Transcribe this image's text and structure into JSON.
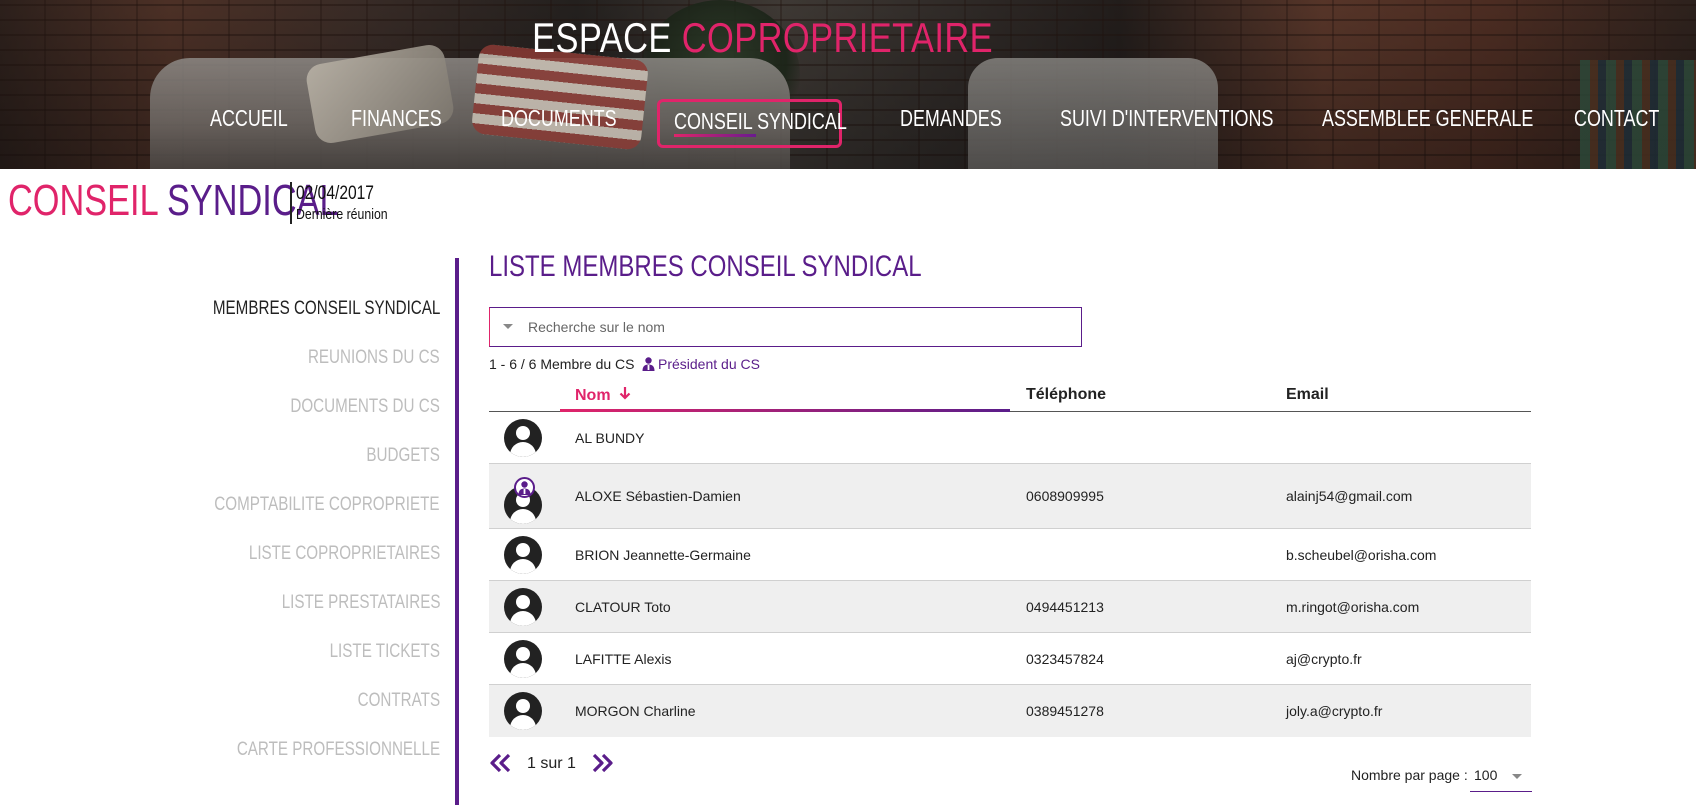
{
  "header": {
    "brand_main": "ESPACE",
    "brand_accent": "COPROPRIETAIRE",
    "nav": [
      {
        "label": "ACCUEIL"
      },
      {
        "label": "FINANCES"
      },
      {
        "label": "DOCUMENTS"
      },
      {
        "label": "CONSEIL SYNDICAL",
        "active": true
      },
      {
        "label": "DEMANDES"
      },
      {
        "label": "SUIVI D'INTERVENTIONS"
      },
      {
        "label": "ASSEMBLEE GENERALE"
      },
      {
        "label": "CONTACT"
      }
    ]
  },
  "page": {
    "title_part1": "CONSEIL",
    "title_part2": "SYNDICAL",
    "meeting_date": "02/04/2017",
    "meeting_label": "Dernière réunion"
  },
  "sidebar": {
    "items": [
      {
        "label": "MEMBRES CONSEIL SYNDICAL",
        "active": true
      },
      {
        "label": "REUNIONS DU CS"
      },
      {
        "label": "DOCUMENTS DU CS"
      },
      {
        "label": "BUDGETS"
      },
      {
        "label": "COMPTABILITE COPROPRIETE"
      },
      {
        "label": "LISTE COPROPRIETAIRES"
      },
      {
        "label": "LISTE PRESTATAIRES"
      },
      {
        "label": "LISTE TICKETS"
      },
      {
        "label": "CONTRATS"
      },
      {
        "label": "CARTE PROFESSIONNELLE"
      }
    ]
  },
  "main": {
    "title": "LISTE MEMBRES CONSEIL SYNDICAL",
    "search_placeholder": "Recherche sur le nom",
    "count_text": "1 - 6 / 6 Membre du CS",
    "president_legend": "Président du CS",
    "columns": {
      "name": "Nom",
      "phone": "Téléphone",
      "email": "Email"
    },
    "members": [
      {
        "name": "AL BUNDY",
        "phone": "",
        "email": "",
        "president": false
      },
      {
        "name": "ALOXE Sébastien-Damien",
        "phone": "0608909995",
        "email": "alainj54@gmail.com",
        "president": true
      },
      {
        "name": "BRION Jeannette-Germaine",
        "phone": "",
        "email": "b.scheubel@orisha.com",
        "president": false
      },
      {
        "name": "CLATOUR Toto",
        "phone": "0494451213",
        "email": "m.ringot@orisha.com",
        "president": false
      },
      {
        "name": "LAFITTE Alexis",
        "phone": "0323457824",
        "email": "aj@crypto.fr",
        "president": false
      },
      {
        "name": "MORGON Charline",
        "phone": "0389451278",
        "email": "joly.a@crypto.fr",
        "president": false
      }
    ]
  },
  "pagination": {
    "page_label": "1 sur 1",
    "per_page_label": "Nombre par page :",
    "per_page_value": "100"
  },
  "colors": {
    "accent_pink": "#e0246a",
    "accent_purple": "#5a1d8a"
  }
}
